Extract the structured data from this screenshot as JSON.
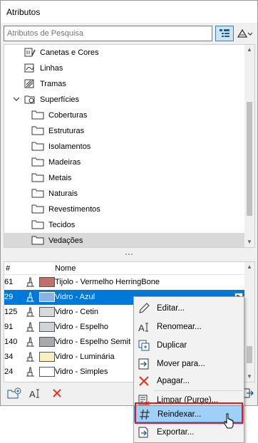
{
  "window": {
    "title": "Atributos"
  },
  "search": {
    "placeholder": "Atributos de Pesquisa"
  },
  "tree": {
    "items": [
      {
        "label": "Canetas e Cores",
        "icon": "pen-colors-icon"
      },
      {
        "label": "Linhas",
        "icon": "lines-icon"
      },
      {
        "label": "Tramas",
        "icon": "hatch-icon"
      },
      {
        "label": "Superfícies",
        "icon": "surfaces-icon",
        "expanded": true
      },
      {
        "label": "Coberturas",
        "icon": "folder-icon"
      },
      {
        "label": "Estruturas",
        "icon": "folder-icon"
      },
      {
        "label": "Isolamentos",
        "icon": "folder-icon"
      },
      {
        "label": "Madeiras",
        "icon": "folder-icon"
      },
      {
        "label": "Metais",
        "icon": "folder-icon"
      },
      {
        "label": "Naturais",
        "icon": "folder-icon"
      },
      {
        "label": "Revestimentos",
        "icon": "folder-icon"
      },
      {
        "label": "Tecidos",
        "icon": "folder-icon"
      },
      {
        "label": "Vedações",
        "icon": "folder-icon",
        "selected": true
      }
    ]
  },
  "table": {
    "headers": {
      "num": "#",
      "name": "Nome"
    },
    "rows": [
      {
        "num": "61",
        "color": "#c0706a",
        "name": "Tijolo - Vermelho HerringBone"
      },
      {
        "num": "29",
        "color": "#8ab4e8",
        "name": "Vidro - Azul",
        "selected": true
      },
      {
        "num": "125",
        "color": "#d6dadc",
        "name": "Vidro - Cetin"
      },
      {
        "num": "91",
        "color": "#d0d4d6",
        "name": "Vidro - Espelho"
      },
      {
        "num": "140",
        "color": "#a7aaad",
        "name": "Vidro - Espelho Semit"
      },
      {
        "num": "34",
        "color": "#f8efc4",
        "name": "Vidro - Luminária"
      },
      {
        "num": "24",
        "color": "#ffffff",
        "name": "Vidro - Simples"
      }
    ]
  },
  "context_menu": {
    "items": [
      {
        "label": "Editar...",
        "icon": "pencil-icon"
      },
      {
        "label": "Renomear...",
        "icon": "rename-icon"
      },
      {
        "label": "Duplicar",
        "icon": "duplicate-icon"
      },
      {
        "label": "Mover para...",
        "icon": "move-to-icon"
      },
      {
        "label": "Apagar...",
        "icon": "delete-icon"
      },
      {
        "label": "Limpar (Purge)...",
        "icon": "purge-icon"
      },
      {
        "label": "Reindexar...",
        "icon": "hash-icon",
        "highlighted": true
      },
      {
        "label": "Exportar...",
        "icon": "export-icon"
      }
    ]
  },
  "colors": {
    "selection": "#0078d7",
    "menu_highlight": "#9fd0f7",
    "red_box": "#e11b22",
    "delete_red": "#e8331f"
  }
}
